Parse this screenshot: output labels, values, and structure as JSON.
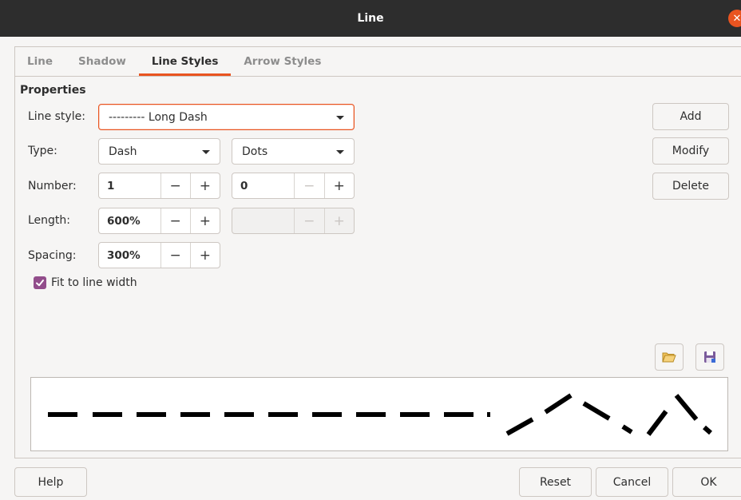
{
  "window": {
    "title": "Line"
  },
  "tabs": [
    {
      "label": "Line",
      "active": false
    },
    {
      "label": "Shadow",
      "active": false
    },
    {
      "label": "Line Styles",
      "active": true
    },
    {
      "label": "Arrow Styles",
      "active": false
    }
  ],
  "properties": {
    "title": "Properties",
    "line_style": {
      "label": "Line style:",
      "value": "--------- Long Dash"
    },
    "type": {
      "label": "Type:",
      "value1": "Dash",
      "value2": "Dots"
    },
    "number": {
      "label": "Number:",
      "value1": "1",
      "value2": "0"
    },
    "length": {
      "label": "Length:",
      "value1": "600%",
      "value2": ""
    },
    "spacing": {
      "label": "Spacing:",
      "value": "300%"
    },
    "fit": {
      "label": "Fit to line width",
      "checked": true
    }
  },
  "side_buttons": {
    "add": "Add",
    "modify": "Modify",
    "delete": "Delete"
  },
  "spin_glyphs": {
    "minus": "−",
    "plus": "+"
  },
  "footer": {
    "help": "Help",
    "reset": "Reset",
    "cancel": "Cancel",
    "ok": "OK"
  },
  "colors": {
    "accent": "#e95420",
    "checkbox": "#924d8b",
    "titlebar": "#2d2d2d"
  },
  "icons": {
    "close": "close-icon",
    "load": "folder-open-icon",
    "save": "save-icon"
  }
}
